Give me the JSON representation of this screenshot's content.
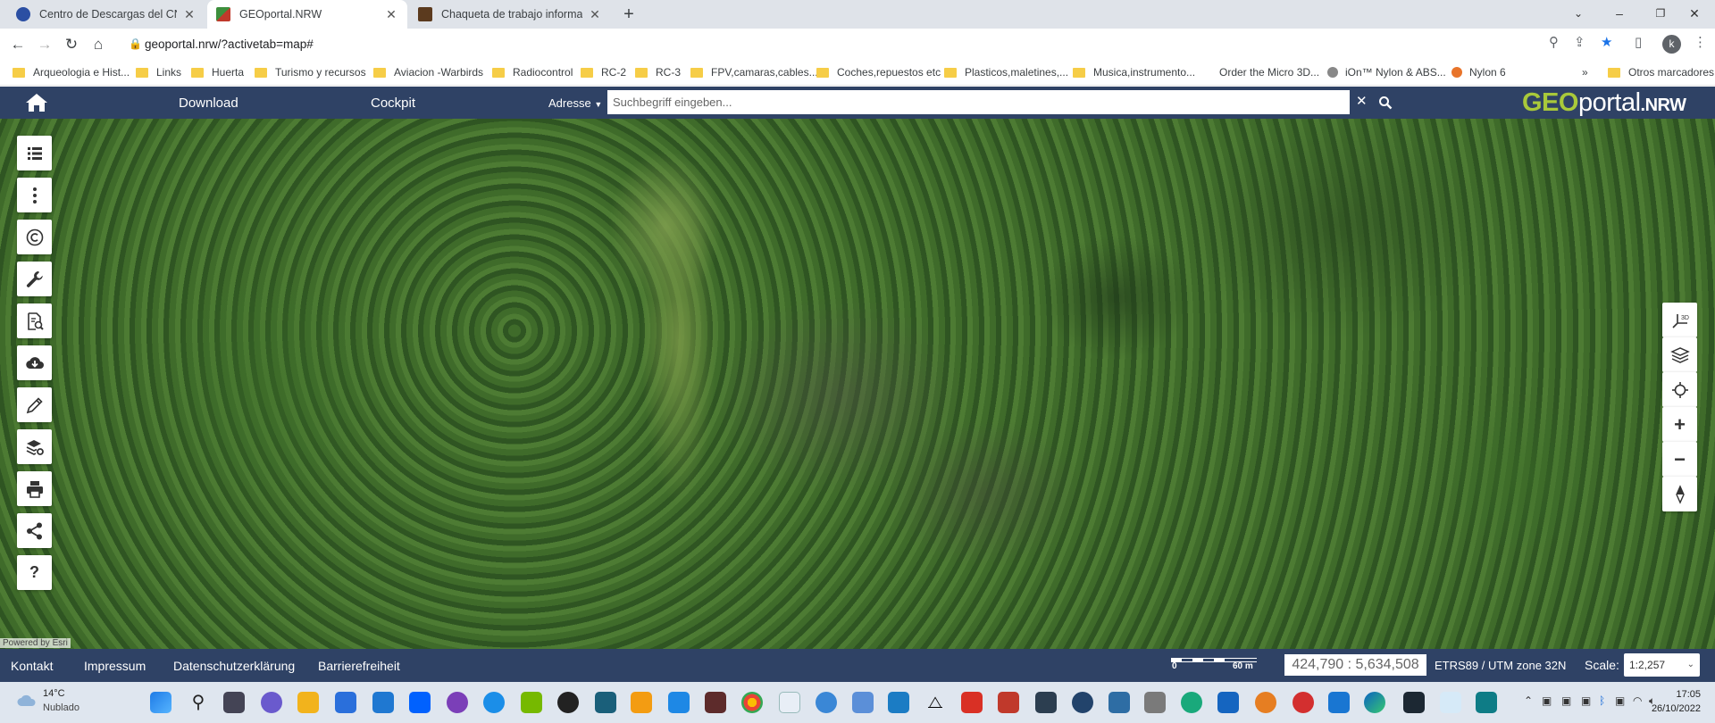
{
  "browser": {
    "tabs": [
      {
        "title": "Centro de Descargas del CNIG (I",
        "favicon_color": "#2b4fa3",
        "active": false
      },
      {
        "title": "GEOportal.NRW",
        "favicon_color": "#3d8f3d",
        "active": true
      },
      {
        "title": "Chaqueta de trabajo informal cá",
        "favicon_color": "#5b3a1e",
        "active": false
      }
    ],
    "new_tab": "+",
    "url": "geoportal.nrw/?activetab=map#",
    "profile_initial": "k"
  },
  "bookmarks": [
    {
      "label": "Arqueologia e Hist...",
      "type": "folder"
    },
    {
      "label": "Links",
      "type": "folder"
    },
    {
      "label": "Huerta",
      "type": "folder"
    },
    {
      "label": "Turismo y recursos",
      "type": "folder"
    },
    {
      "label": "Aviacion -Warbirds",
      "type": "folder"
    },
    {
      "label": "Radiocontrol",
      "type": "folder"
    },
    {
      "label": "RC-2",
      "type": "folder"
    },
    {
      "label": "RC-3",
      "type": "folder"
    },
    {
      "label": "FPV,camaras,cables...",
      "type": "folder"
    },
    {
      "label": "Coches,repuestos etc",
      "type": "folder"
    },
    {
      "label": "Plasticos,maletines,...",
      "type": "folder"
    },
    {
      "label": "Musica,instrumento...",
      "type": "folder"
    },
    {
      "label": "Order the Micro 3D...",
      "type": "link"
    },
    {
      "label": "iOn™ Nylon & ABS...",
      "type": "link"
    },
    {
      "label": "Nylon 6",
      "type": "link"
    }
  ],
  "bookmarks_more": "»",
  "bookmarks_other": "Otros marcadores",
  "geoportal": {
    "nav_download": "Download",
    "nav_cockpit": "Cockpit",
    "search_scope": "Adresse",
    "search_placeholder": "Suchbegriff eingeben...",
    "logo_geo": "GEO",
    "logo_portal": "portal",
    "logo_nrw": ".NRW",
    "attribution": "Powered by Esri",
    "tools_right_3d": "3D"
  },
  "footer": {
    "kontakt": "Kontakt",
    "impressum": "Impressum",
    "datenschutz": "Datenschutzerklärung",
    "barrierefreiheit": "Barrierefreiheit",
    "scalebar_start": "0",
    "scalebar_end": "60 m",
    "coordinates": "424,790 : 5,634,508",
    "crs": "ETRS89 / UTM zone 32N",
    "scale_label": "Scale:",
    "scale_value": "1:2,257"
  },
  "taskbar": {
    "temperature": "14°C",
    "weather": "Nublado",
    "time": "17:05",
    "date": "26/10/2022"
  }
}
